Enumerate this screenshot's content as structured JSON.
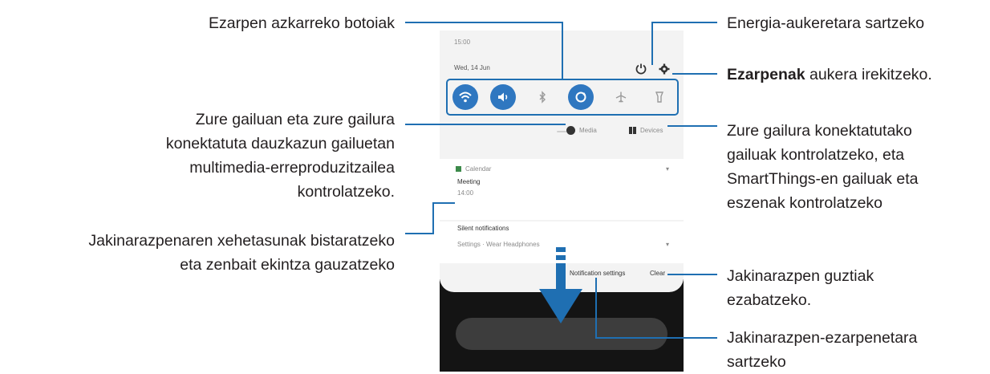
{
  "annotations": {
    "quick_settings": "Ezarpen azkarreko botoiak",
    "media": [
      "Zure gailuan eta zure gailura",
      "konektatuta dauzkazun gailuetan",
      "multimedia-erreproduzitzailea",
      "kontrolatzeko."
    ],
    "notification_details": [
      "Jakinarazpenaren xehetasunak bistaratzeko",
      "eta zenbait ekintza gauzatzeko"
    ],
    "power": "Energia-aukeretara sartzeko",
    "settings_bold": "Ezarpenak",
    "settings_rest": " aukera irekitzeko.",
    "devices": [
      "Zure gailura konektatutako",
      "gailuak kontrolatzeko, eta",
      "SmartThings-en gailuak eta",
      "eszenak kontrolatzeko"
    ],
    "clear_all": [
      "Jakinarazpen guztiak",
      "ezabatzeko."
    ],
    "notif_settings": [
      "Jakinarazpen-ezarpenetara",
      "sartzeko"
    ]
  },
  "phone": {
    "time": "15:00",
    "date": "Wed, 14 Jun",
    "media_label": "Media",
    "devices_label": "Devices",
    "notif_app": "Calendar",
    "notif_title": "Meeting",
    "notif_sub": "14:00",
    "silent_label": "Silent notifications",
    "silent_item": "Settings  ·  Wear Headphones",
    "notif_settings_btn": "Notification settings",
    "clear_btn": "Clear",
    "qs_buttons": [
      "wifi-icon",
      "sound-icon",
      "bluetooth-icon",
      "auto-rotate-icon",
      "airplane-icon",
      "flashlight-icon"
    ]
  },
  "colors": {
    "accent": "#1f6fb2",
    "toggle_on": "#2f77c0"
  }
}
